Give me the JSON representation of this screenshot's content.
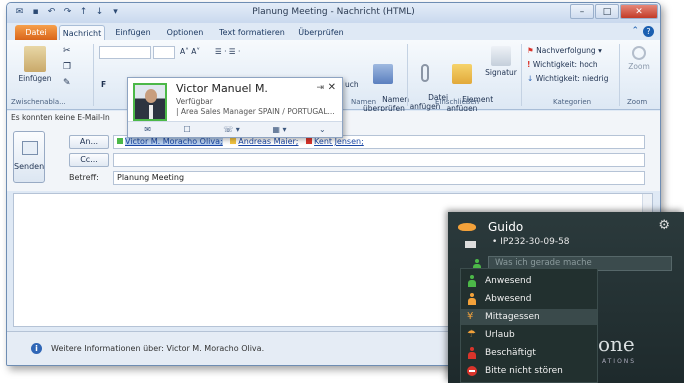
{
  "window": {
    "title": "Planung Meeting - Nachricht (HTML)",
    "controls": {
      "minimize": "–",
      "maximize": "□",
      "close": "✕"
    }
  },
  "tabs": [
    {
      "label": "Datei"
    },
    {
      "label": "Nachricht"
    },
    {
      "label": "Einfügen"
    },
    {
      "label": "Optionen"
    },
    {
      "label": "Text formatieren"
    },
    {
      "label": "Überprüfen"
    }
  ],
  "ribbon": {
    "paste_label": "Einfügen",
    "clipboard_group": "Zwischenabla...",
    "check_names": "Namen\nüberprüfen",
    "names_group": "Namen",
    "attach_file": "Datei\nanfügen",
    "attach_item": "Element\nanfügen",
    "signature": "Signatur",
    "include_group": "Einschließen",
    "followup": "Nachverfolgung",
    "high_importance": "Wichtigkeit: hoch",
    "low_importance": "Wichtigkeit: niedrig",
    "tags_group": "Kategorien",
    "zoom_label": "Zoom",
    "zoom_group": "Zoom",
    "partial_label": "uch"
  },
  "infobar": {
    "text": "Es konnten keine E-Mail-In"
  },
  "compose": {
    "send": "Senden",
    "to_btn": "An...",
    "cc_btn": "Cc...",
    "subject_label": "Betreff:",
    "subject_value": "Planung Meeting",
    "recipients": [
      {
        "name": "Victor M. Moracho Oliva;",
        "color": "#4cb848"
      },
      {
        "name": "Andreas Maier;",
        "color": "#f4c542"
      },
      {
        "name": "Kent Jensen;",
        "color": "#d9342b"
      }
    ]
  },
  "contact_card": {
    "name": "Victor Manuel M.",
    "status": "Verfügbar",
    "job": "| Area Sales Manager SPAIN / PORTUGAL..."
  },
  "people_pane": {
    "text": "Weitere Informationen über: Victor M. Moracho Oliva."
  },
  "presence": {
    "user": "Guido",
    "ip": "• IP232-30-09-58",
    "status_placeholder": "Was ich gerade mache",
    "brand": "one",
    "brand_sub": "ATIONS",
    "menu": [
      {
        "label": "Anwesend",
        "color": "#4cb848"
      },
      {
        "label": "Abwesend",
        "color": "#f4a23a"
      },
      {
        "label": "Mittagessen",
        "color": "#f4a23a"
      },
      {
        "label": "Urlaub",
        "color": "#f4a23a"
      },
      {
        "label": "Beschäftigt",
        "color": "#d9342b"
      },
      {
        "label": "Bitte nicht stören",
        "color": "#d9342b"
      }
    ]
  }
}
